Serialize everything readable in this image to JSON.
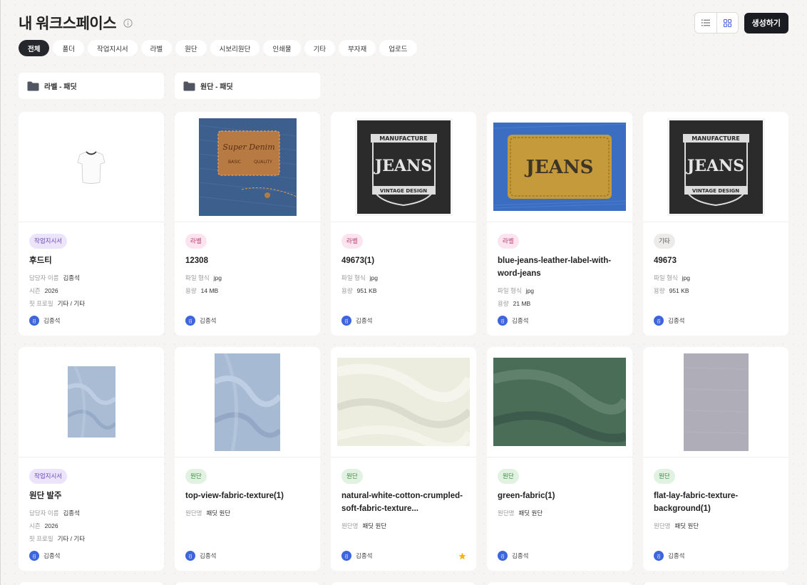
{
  "header": {
    "title": "내 워크스페이스",
    "create_label": "생성하기"
  },
  "filters": [
    "전체",
    "폴더",
    "작업지시서",
    "라벨",
    "원단",
    "시보리원단",
    "인쇄물",
    "기타",
    "부자재",
    "업로드"
  ],
  "folders": [
    "라벨 - 패딧",
    "원단 - 패딧"
  ],
  "owner_initial": "김",
  "cards": [
    {
      "tag": "작업지시서",
      "name": "후드티",
      "meta": [
        [
          "담당자 이름",
          "김종석"
        ],
        [
          "시즌",
          "2026"
        ],
        [
          "핏 프로필",
          "기타 / 기타"
        ]
      ],
      "owner": "김종석"
    },
    {
      "tag": "라벨",
      "name": "12308",
      "meta": [
        [
          "파일 형식",
          "jpg"
        ],
        [
          "용량",
          "14 MB"
        ]
      ],
      "owner": "김종석"
    },
    {
      "tag": "라벨",
      "name": "49673(1)",
      "meta": [
        [
          "파일 형식",
          "jpg"
        ],
        [
          "용량",
          "951 KB"
        ]
      ],
      "owner": "김종석"
    },
    {
      "tag": "라벨",
      "name": "blue-jeans-leather-label-with-word-jeans",
      "meta": [
        [
          "파일 형식",
          "jpg"
        ],
        [
          "용량",
          "21 MB"
        ]
      ],
      "owner": "김종석"
    },
    {
      "tag": "기타",
      "name": "49673",
      "meta": [
        [
          "파일 형식",
          "jpg"
        ],
        [
          "용량",
          "951 KB"
        ]
      ],
      "owner": "김종석"
    },
    {
      "tag": "작업지시서",
      "name": "원단 발주",
      "meta": [
        [
          "담당자 이름",
          "김종석"
        ],
        [
          "시즌",
          "2026"
        ],
        [
          "핏 프로필",
          "기타 / 기타"
        ]
      ],
      "owner": "김종석"
    },
    {
      "tag": "원단",
      "name": "top-view-fabric-texture(1)",
      "meta": [
        [
          "원단명",
          "패딧 원단"
        ]
      ],
      "owner": "김종석"
    },
    {
      "tag": "원단",
      "name": "natural-white-cotton-crumpled-soft-fabric-texture...",
      "meta": [
        [
          "원단명",
          "패딧 원단"
        ]
      ],
      "owner": "김종석",
      "starred": true
    },
    {
      "tag": "원단",
      "name": "green-fabric(1)",
      "meta": [
        [
          "원단명",
          "패딧 원단"
        ]
      ],
      "owner": "김종석"
    },
    {
      "tag": "원단",
      "name": "flat-lay-fabric-texture-background(1)",
      "meta": [
        [
          "원단명",
          "패딧 원단"
        ]
      ],
      "owner": "김종석"
    }
  ],
  "colors": {
    "accent": "#3d66dd",
    "button_dark": "#1b1c22",
    "star": "#f1b81c"
  }
}
